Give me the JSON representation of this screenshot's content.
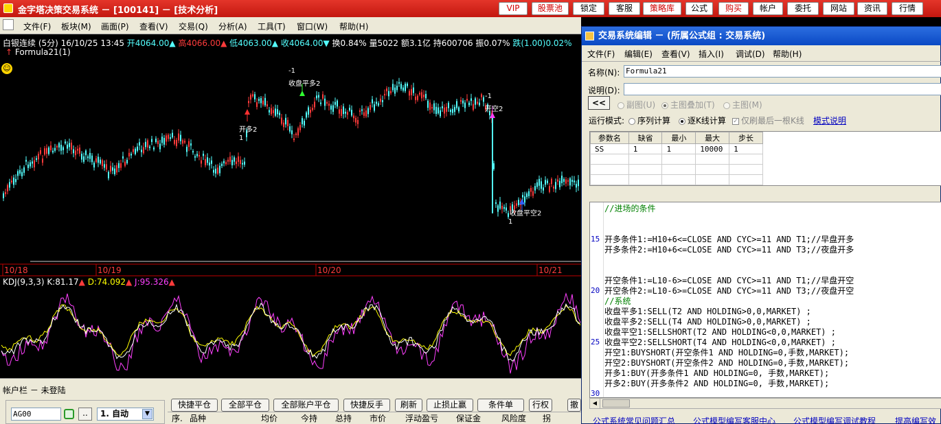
{
  "window": {
    "title": "金字塔决策交易系统 － [100141] － [技术分析]"
  },
  "top_buttons": [
    {
      "label": "VIP",
      "red": true
    },
    {
      "label": "股票池",
      "red": true
    },
    {
      "label": "锁定",
      "red": false
    },
    {
      "label": "客服",
      "red": false
    },
    {
      "label": "策略库",
      "red": true
    },
    {
      "label": "公式",
      "red": false
    },
    {
      "label": "购买",
      "red": true
    },
    {
      "label": "帐户",
      "red": false
    },
    {
      "label": "委托",
      "red": false
    },
    {
      "label": "网站",
      "red": false
    },
    {
      "label": "资讯",
      "red": false
    },
    {
      "label": "行情",
      "red": false
    }
  ],
  "menu": [
    "文件(F)",
    "板块(M)",
    "画面(P)",
    "查看(V)",
    "交易(Q)",
    "分析(A)",
    "工具(T)",
    "窗口(W)",
    "帮助(H)"
  ],
  "quote": {
    "symbol": "白银连续 (5分)",
    "datetime": "16/10/25 13:45",
    "open": "开4064.00",
    "high": "高4066.00",
    "low": "低4063.00",
    "close": "收4064.00",
    "turnover": "换0.84%",
    "volume": "量5022",
    "amount": "额3.1亿",
    "position": "持600706",
    "amplitude": "振0.07%",
    "change": "跌(1.00)0.02%"
  },
  "formula_label": "Formula21(1)",
  "signals": [
    {
      "label": "开多2",
      "qty": "1",
      "color": "#ff3030"
    },
    {
      "label": "收盘平多2",
      "qty": "-1",
      "color": "#30ff30"
    },
    {
      "label": "开空2",
      "qty": "-1",
      "color": "#ff40ff"
    },
    {
      "label": "收盘平空2",
      "qty": "1",
      "color": "#3060ff"
    }
  ],
  "dates": [
    "10/18",
    "10/19",
    "10/20",
    "10/21"
  ],
  "kdj": {
    "name": "KDJ(9,3,3)",
    "k": "K:81.17",
    "d": "D:74.092",
    "j": "J:95.326"
  },
  "account_bar": {
    "title": "帐户栏 － 未登陆",
    "code_input": "AG00",
    "more": "..",
    "mode": "1. 自动"
  },
  "bottom_buttons": [
    "快捷平仓",
    "全部平仓",
    "全部账户平仓",
    "快捷反手",
    "刷新",
    "止损止赢",
    "条件单",
    "行权",
    "撤"
  ],
  "table_headers": [
    "序.",
    "品种",
    "均价",
    "今持",
    "总持",
    "市价",
    "浮动盈亏",
    "保证金",
    "风险度",
    "拐"
  ],
  "dialog": {
    "title": "交易系统编辑 － (所属公式组 : 交易系统)",
    "menu": [
      "文件(F)",
      "编辑(E)",
      "查看(V)",
      "插入(I)",
      "调试(D)",
      "帮助(H)"
    ],
    "name_label": "名称(N):",
    "name_value": "Formula21",
    "desc_label": "说明(D):",
    "desc_value": "",
    "back_btn": "<<",
    "chart_modes": [
      "副图(U)",
      "主图叠加(T)",
      "主图(M)"
    ],
    "run_mode_label": "运行模式:",
    "run_modes": [
      "序列计算",
      "逐K线计算"
    ],
    "last_bar_only": "仅刷最后一根K线",
    "mode_help": "模式说明",
    "param_headers": [
      "参数名",
      "缺省",
      "最小",
      "最大",
      "步长"
    ],
    "param_rows": [
      [
        "SS",
        "1",
        "1",
        "10000",
        "1"
      ]
    ],
    "code_lines": [
      {
        "n": "",
        "t": "//进场的条件"
      },
      {
        "n": "",
        "t": ""
      },
      {
        "n": "15",
        "t": "开多条件1:=H10+6<=CLOSE AND CYC>=11 AND T1;//早盘开多"
      },
      {
        "n": "",
        "t": "开多条件2:=H10+6<=CLOSE AND CYC>=11 AND T3;//夜盘开多"
      },
      {
        "n": "",
        "t": ""
      },
      {
        "n": "",
        "t": "开空条件1:=L10-6>=CLOSE AND CYC>=11 AND T1;//早盘开空"
      },
      {
        "n": "20",
        "t": "开空条件2:=L10-6>=CLOSE AND CYC>=11 AND T3;//夜盘开空"
      },
      {
        "n": "",
        "t": "//系统"
      },
      {
        "n": "",
        "t": "收盘平多1:SELL(T2 AND HOLDING>0,0,MARKET) ;"
      },
      {
        "n": "",
        "t": "收盘平多2:SELL(T4 AND HOLDING>0,0,MARKET) ;"
      },
      {
        "n": "",
        "t": "收盘平空1:SELLSHORT(T2 AND HOLDING<0,0,MARKET) ;"
      },
      {
        "n": "25",
        "t": "收盘平空2:SELLSHORT(T4 AND HOLDING<0,0,MARKET) ;"
      },
      {
        "n": "",
        "t": "开空1:BUYSHORT(开空条件1 AND HOLDING=0,手数,MARKET);"
      },
      {
        "n": "",
        "t": "开空2:BUYSHORT(开空条件2 AND HOLDING=0,手数,MARKET);"
      },
      {
        "n": "",
        "t": "开多1:BUY(开多条件1 AND HOLDING=0, 手数,MARKET);"
      },
      {
        "n": "",
        "t": "开多2:BUY(开多条件2 AND HOLDING=0, 手数,MARKET);"
      },
      {
        "n": "30",
        "t": ""
      }
    ],
    "links": [
      "公式系统常见问题汇总",
      "公式模型编写客服中心",
      "公式模型编写调试教程",
      "提高编写效"
    ]
  },
  "colors": {
    "title_red": "#d4251b",
    "up": "#ff3b3b",
    "down": "#54ffff",
    "k_line": "#ffffff",
    "d_line": "#ffff00",
    "j_line": "#ff40ff"
  }
}
